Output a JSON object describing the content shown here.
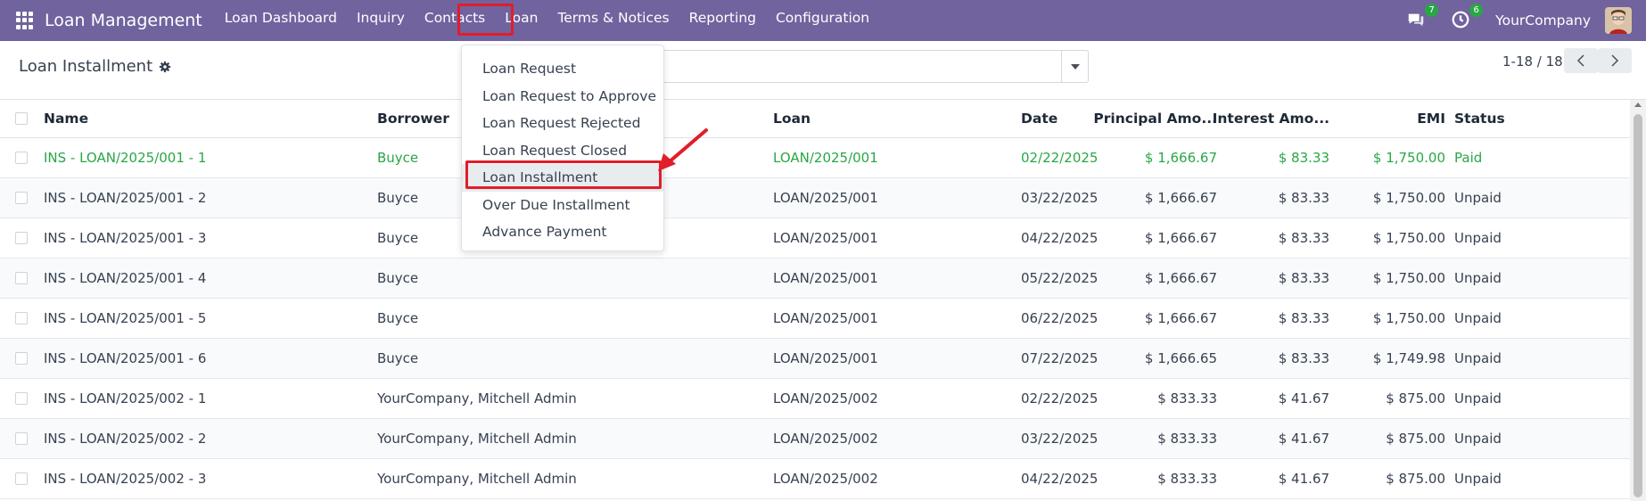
{
  "navbar": {
    "brand": "Loan Management",
    "menu": [
      "Loan Dashboard",
      "Inquiry",
      "Contacts",
      "Loan",
      "Terms & Notices",
      "Reporting",
      "Configuration"
    ],
    "chat_badge": "7",
    "activity_badge": "6",
    "company": "YourCompany",
    "bg_color": "#71639e"
  },
  "control_panel": {
    "title": "Loan Installment",
    "pager": "1-18 / 18"
  },
  "dropdown": {
    "items": [
      "Loan Request",
      "Loan Request to Approve",
      "Loan Request Rejected",
      "Loan Request Closed",
      "Loan Installment",
      "Over Due Installment",
      "Advance Payment"
    ],
    "selected": "Loan Installment"
  },
  "table": {
    "headers": {
      "name": "Name",
      "borrower": "Borrower",
      "loan": "Loan",
      "date": "Date",
      "principal": "Principal Amo...",
      "interest": "Interest Amo...",
      "emi": "EMI",
      "status": "Status"
    },
    "rows": [
      {
        "name": "INS - LOAN/2025/001 - 1",
        "borrower": "Buyce",
        "loan": "LOAN/2025/001",
        "date": "02/22/2025",
        "principal": "$ 1,666.67",
        "interest": "$ 83.33",
        "emi": "$ 1,750.00",
        "status": "Paid"
      },
      {
        "name": "INS - LOAN/2025/001 - 2",
        "borrower": "Buyce",
        "loan": "LOAN/2025/001",
        "date": "03/22/2025",
        "principal": "$ 1,666.67",
        "interest": "$ 83.33",
        "emi": "$ 1,750.00",
        "status": "Unpaid"
      },
      {
        "name": "INS - LOAN/2025/001 - 3",
        "borrower": "Buyce",
        "loan": "LOAN/2025/001",
        "date": "04/22/2025",
        "principal": "$ 1,666.67",
        "interest": "$ 83.33",
        "emi": "$ 1,750.00",
        "status": "Unpaid"
      },
      {
        "name": "INS - LOAN/2025/001 - 4",
        "borrower": "Buyce",
        "loan": "LOAN/2025/001",
        "date": "05/22/2025",
        "principal": "$ 1,666.67",
        "interest": "$ 83.33",
        "emi": "$ 1,750.00",
        "status": "Unpaid"
      },
      {
        "name": "INS - LOAN/2025/001 - 5",
        "borrower": "Buyce",
        "loan": "LOAN/2025/001",
        "date": "06/22/2025",
        "principal": "$ 1,666.67",
        "interest": "$ 83.33",
        "emi": "$ 1,750.00",
        "status": "Unpaid"
      },
      {
        "name": "INS - LOAN/2025/001 - 6",
        "borrower": "Buyce",
        "loan": "LOAN/2025/001",
        "date": "07/22/2025",
        "principal": "$ 1,666.65",
        "interest": "$ 83.33",
        "emi": "$ 1,749.98",
        "status": "Unpaid"
      },
      {
        "name": "INS - LOAN/2025/002 - 1",
        "borrower": "YourCompany, Mitchell Admin",
        "loan": "LOAN/2025/002",
        "date": "02/22/2025",
        "principal": "$ 833.33",
        "interest": "$ 41.67",
        "emi": "$ 875.00",
        "status": "Unpaid"
      },
      {
        "name": "INS - LOAN/2025/002 - 2",
        "borrower": "YourCompany, Mitchell Admin",
        "loan": "LOAN/2025/002",
        "date": "03/22/2025",
        "principal": "$ 833.33",
        "interest": "$ 41.67",
        "emi": "$ 875.00",
        "status": "Unpaid"
      },
      {
        "name": "INS - LOAN/2025/002 - 3",
        "borrower": "YourCompany, Mitchell Admin",
        "loan": "LOAN/2025/002",
        "date": "04/22/2025",
        "principal": "$ 833.33",
        "interest": "$ 41.67",
        "emi": "$ 875.00",
        "status": "Unpaid"
      }
    ]
  }
}
